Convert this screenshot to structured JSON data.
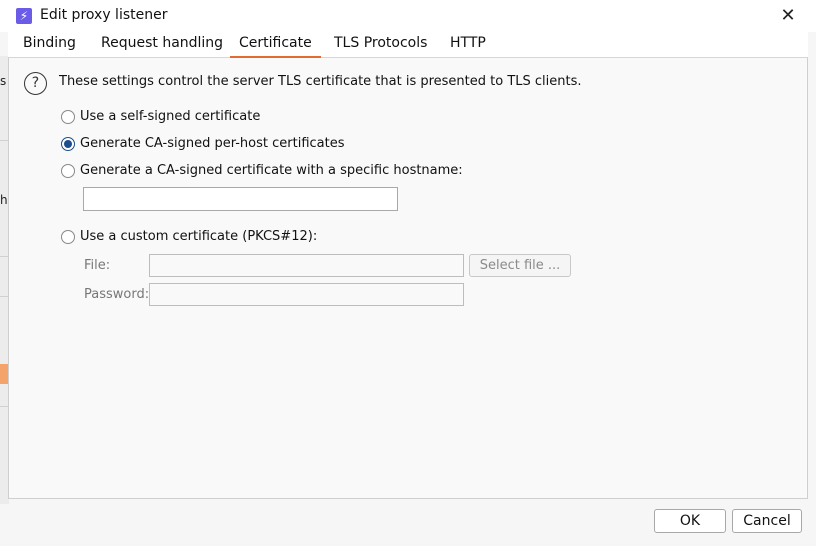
{
  "window": {
    "title": "Edit proxy listener",
    "icon": "lightning-icon",
    "close_glyph": "✕"
  },
  "tabs": [
    {
      "label": "Binding"
    },
    {
      "label": "Request handling"
    },
    {
      "label": "Certificate",
      "active": true
    },
    {
      "label": "TLS Protocols"
    },
    {
      "label": "HTTP"
    }
  ],
  "certificate": {
    "help_glyph": "?",
    "help_text": "These settings control the server TLS certificate that is presented to TLS clients.",
    "options": [
      {
        "label": "Use a self-signed certificate",
        "selected": false
      },
      {
        "label": "Generate CA-signed per-host certificates",
        "selected": true
      },
      {
        "label": "Generate a CA-signed certificate with a specific hostname:",
        "selected": false
      },
      {
        "label": "Use a custom certificate (PKCS#12):",
        "selected": false
      }
    ],
    "hostname_value": "",
    "file_label": "File:",
    "file_value": "",
    "select_file_label": "Select file ...",
    "password_label": "Password:",
    "password_value": ""
  },
  "footer": {
    "ok_label": "OK",
    "cancel_label": "Cancel"
  },
  "background": {
    "fragments": [
      "s",
      "h"
    ]
  },
  "colors": {
    "accent_tab_underline": "#e36b2f",
    "radio_selected": "#1e4e8c",
    "app_icon": "#6b5ce7"
  }
}
